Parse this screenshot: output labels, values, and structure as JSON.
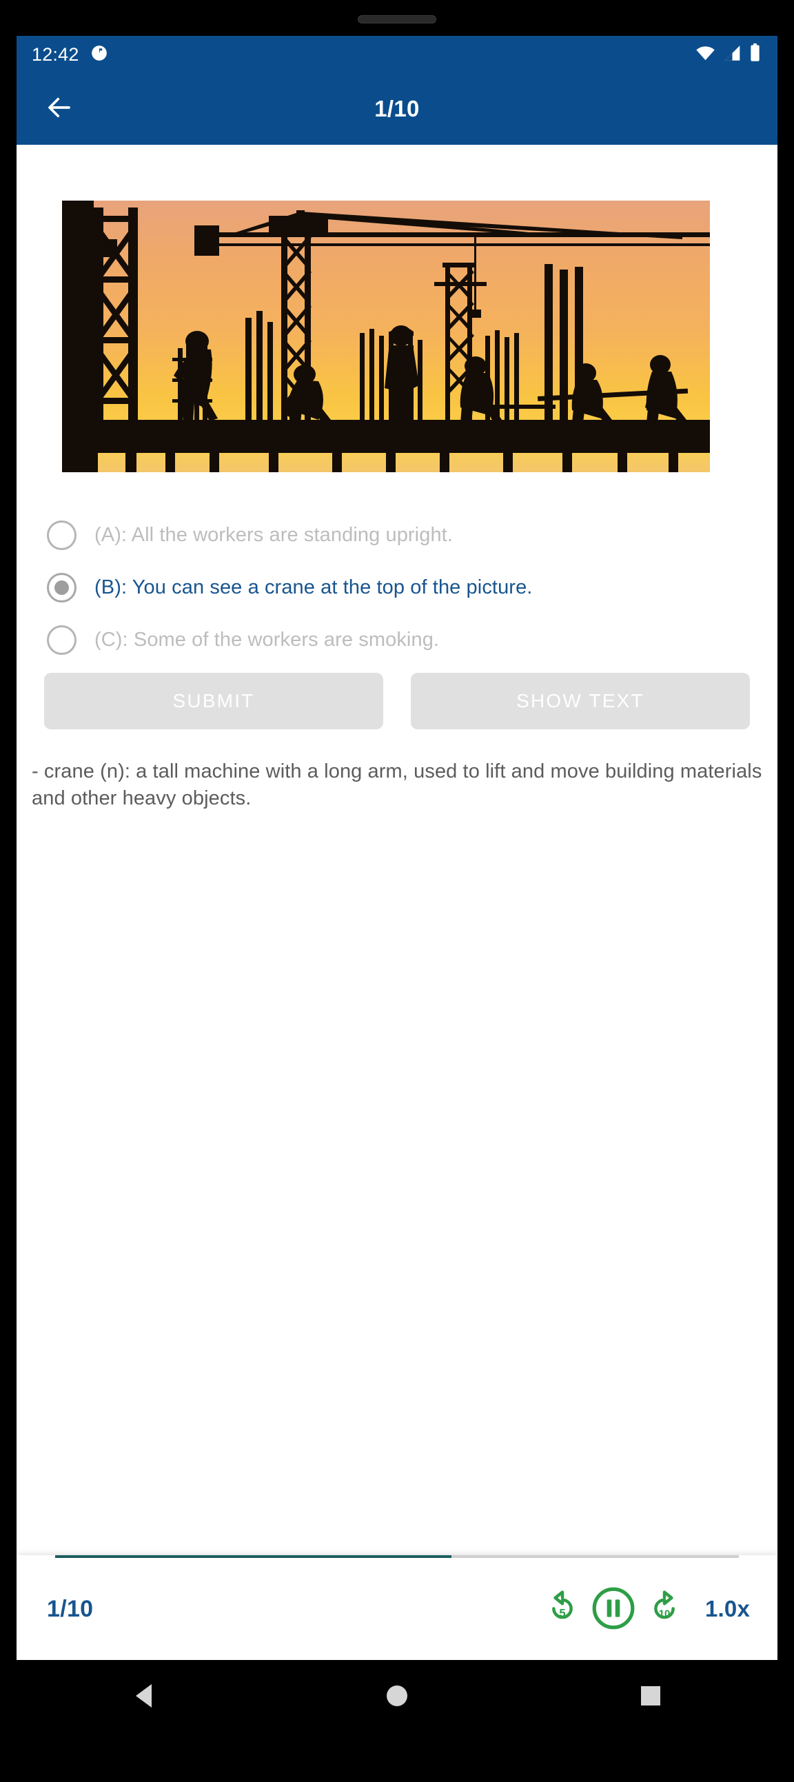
{
  "status_bar": {
    "time": "12:42",
    "icons": [
      "clock-badge-icon",
      "wifi-icon",
      "cellular-signal-icon",
      "battery-icon"
    ]
  },
  "app_bar": {
    "back_icon": "arrow-left-icon",
    "title": "1/10"
  },
  "question": {
    "image_alt": "construction-site-silhouette-photo",
    "options": [
      {
        "id": "A",
        "label": "(A): All the workers are standing upright.",
        "selected": false
      },
      {
        "id": "B",
        "label": "(B): You can see a crane at the top of the picture.",
        "selected": true
      },
      {
        "id": "C",
        "label": "(C): Some of the workers are smoking.",
        "selected": false
      }
    ]
  },
  "actions": {
    "submit_label": "SUBMIT",
    "show_text_label": "SHOW TEXT"
  },
  "vocabulary": {
    "note": "- crane (n): a tall machine with a long arm, used to lift and move building materials and other heavy objects."
  },
  "player": {
    "progress_label": "1/10",
    "progress_percent": 58,
    "rewind_label": "5",
    "forward_label": "10",
    "speed_label": "1.0x",
    "state": "playing",
    "rewind_icon": "replay-5-icon",
    "pause_icon": "pause-circle-icon",
    "forward_icon": "forward-10-icon"
  },
  "nav_bar": {
    "back": "nav-back-icon",
    "home": "nav-home-icon",
    "recents": "nav-recents-icon"
  },
  "colors": {
    "app_bar": "#0B4D8C",
    "accent_blue": "#18558F",
    "accent_green": "#2E9E46",
    "progress": "#1D5E60",
    "disabled_button": "#E0E0E0",
    "muted_text": "#BDBDBD"
  }
}
